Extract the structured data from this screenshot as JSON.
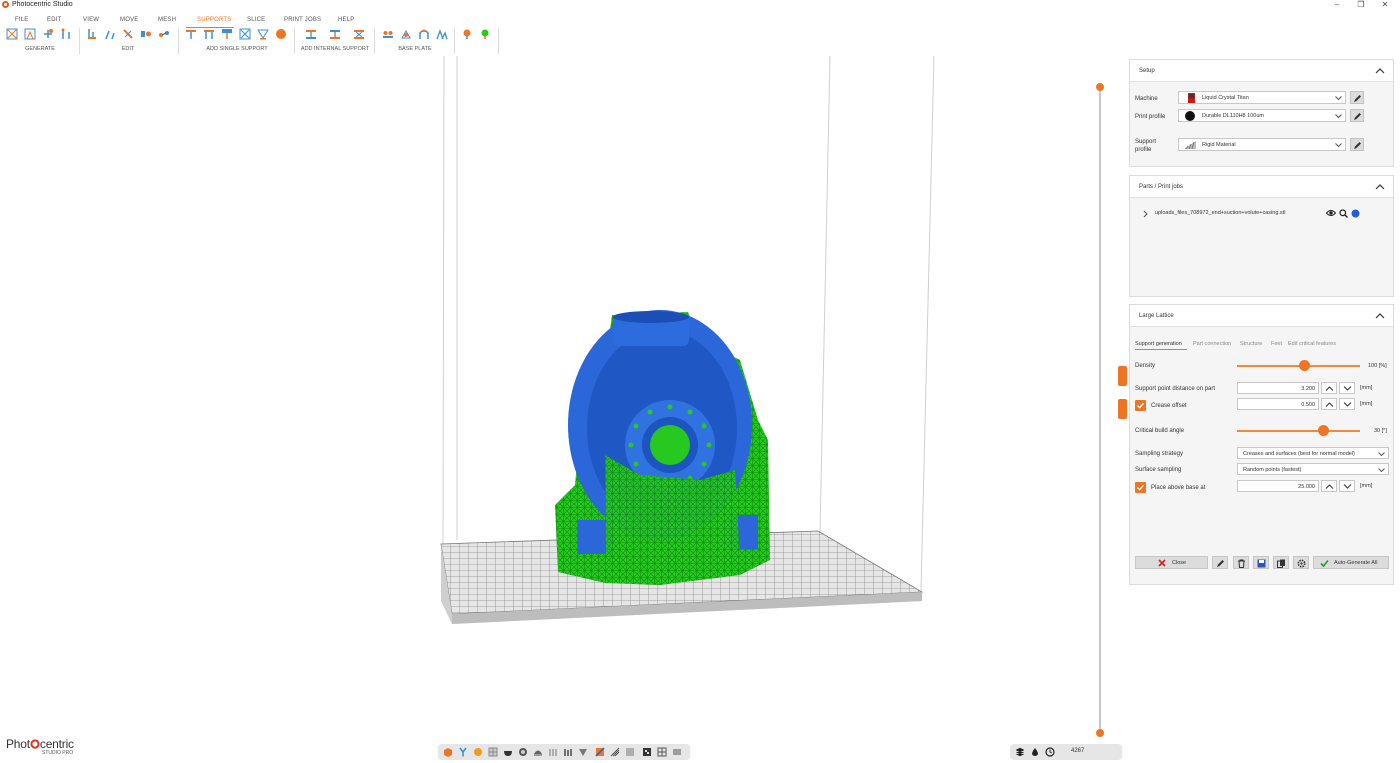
{
  "app": {
    "title": "Photocentric Studio",
    "window_controls": [
      "–",
      "❐",
      "✕"
    ]
  },
  "menu": [
    "FILE",
    "EDIT",
    "VIEW",
    "MOVE",
    "MESH",
    "SUPPORTS",
    "SLICE",
    "PRINT JOBS",
    "HELP"
  ],
  "menu_active": "SUPPORTS",
  "ribbon_groups": [
    "GENERATE",
    "EDIT",
    "ADD SINGLE SUPPORT",
    "ADD INTERNAL SUPPORT",
    "BASE PLATE"
  ],
  "setup": {
    "title": "Setup",
    "machine_label": "Machine",
    "machine_value": "Liquid Crystal Titan",
    "print_profile_label": "Print profile",
    "print_profile_value": "Durable DL110H8 100um",
    "support_profile_label_1": "Support",
    "support_profile_label_2": "profile",
    "support_profile_value": "Rigid Material"
  },
  "parts": {
    "title": "Parts / Print jobs",
    "items": [
      "uploads_files_708972_end+suction+volute+casing.stl"
    ]
  },
  "lattice": {
    "title": "Large Lattice",
    "tabs": [
      "Support generation",
      "Part connection",
      "Structure",
      "Feet",
      "Edit critical features"
    ],
    "active_tab": 0,
    "density_label": "Density",
    "density_value": "100 [%]",
    "density_level": 0.55,
    "spd_label": "Support point distance on part",
    "spd_value": "3.200",
    "spd_unit": "[mm]",
    "crease_label": "Crease offset",
    "crease_checked": true,
    "crease_value": "0.500",
    "crease_unit": "[mm]",
    "cba_label": "Critical build angle",
    "cba_value": "30 [°]",
    "cba_level": 0.7,
    "sampling_label": "Sampling strategy",
    "sampling_value": "Creases and surfaces (best for normal model)",
    "surface_label": "Surface sampling",
    "surface_value": "Random points (fastest)",
    "above_label": "Place above base at",
    "above_checked": true,
    "above_value": "25.000",
    "above_unit": "[mm]",
    "close_label": "Close",
    "autogen_label": "Auto-Generate All"
  },
  "status": {
    "count": "4267"
  },
  "brand": {
    "name_a": "Phot",
    "name_b": "centric",
    "sub": "STUDIO PRO"
  },
  "colors": {
    "accent": "#ee7523",
    "model": "#2060d0",
    "supports": "#1ed418",
    "plate": "#a8a8a8"
  }
}
